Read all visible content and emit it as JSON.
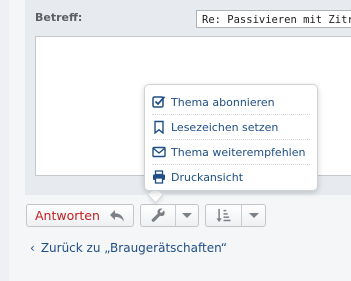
{
  "form": {
    "subject_label": "Betreff:",
    "subject_value": "Re: Passivieren mit Zitron"
  },
  "actions": {
    "reply_label": "Antworten"
  },
  "tools_menu": {
    "items": [
      {
        "label": "Thema abonnieren",
        "icon": "checkbox-icon"
      },
      {
        "label": "Lesezeichen setzen",
        "icon": "bookmark-icon"
      },
      {
        "label": "Thema weiterempfehlen",
        "icon": "envelope-icon"
      },
      {
        "label": "Druckansicht",
        "icon": "printer-icon"
      }
    ]
  },
  "navigation": {
    "back_link": "Zurück zu „Braugerätschaften“"
  },
  "colors": {
    "accent_link": "#1f4f84",
    "reply_text": "#c22020"
  }
}
